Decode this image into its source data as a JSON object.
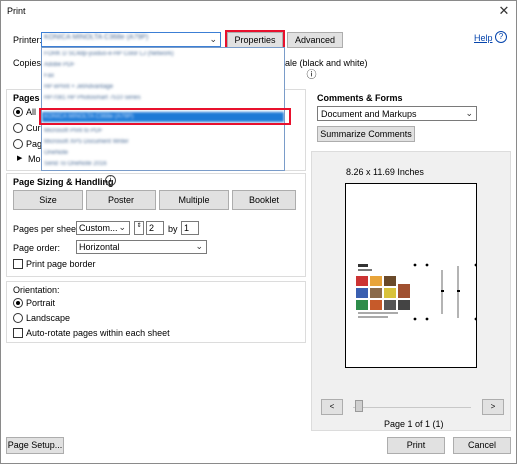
{
  "window": {
    "title": "Print",
    "close_glyph": "✕"
  },
  "printer": {
    "label": "Printer:",
    "selected": "KONICA MINOLTA C368e (A79P)",
    "properties_label": "Properties",
    "advanced_label": "Advanced",
    "help_label": "Help",
    "dropdown_items": [
      "FORK D SC4dp-yuiduo-e-HP Color LJ (Network)",
      "Adobe PDF",
      "Fax",
      "HP ePrint + JetAdvantage",
      "HP7081 HP Photosmart 7510 series",
      "KONICA MINOLTA C368e (A79P)",
      "Microsoft Print to PDF",
      "Microsoft XPS Document Writer",
      "OneNote",
      "Send To OneNote 2016"
    ]
  },
  "copies": {
    "label": "Copies:",
    "grayscale_label": "ale (black and white)",
    "info_glyph": "ⓘ"
  },
  "pages_to_print": {
    "header": "Pages t",
    "all": "All",
    "current": "Cur",
    "pages": "Page",
    "more": "Mo"
  },
  "comments": {
    "header": "Comments & Forms",
    "selected": "Document and Markups",
    "summarize_label": "Summarize Comments"
  },
  "sizing": {
    "header": "Page Sizing & Handling",
    "tabs": [
      "Size",
      "Poster",
      "Multiple",
      "Booklet"
    ],
    "pages_per_sheet_label": "Pages per sheet:",
    "pages_per_sheet_value": "Custom...",
    "cols": "2",
    "by_label": "by",
    "rows": "1",
    "page_order_label": "Page order:",
    "page_order_value": "Horizontal",
    "print_border_label": "Print page border"
  },
  "orientation": {
    "header": "Orientation:",
    "portrait": "Portrait",
    "landscape": "Landscape",
    "auto_rotate": "Auto-rotate pages within each sheet"
  },
  "preview": {
    "size_label": "8.26 x 11.69 Inches",
    "page_indicator": "Page 1 of 1 (1)",
    "prev_glyph": "<",
    "next_glyph": ">"
  },
  "footer": {
    "page_setup_label": "Page Setup...",
    "print_label": "Print",
    "cancel_label": "Cancel"
  }
}
